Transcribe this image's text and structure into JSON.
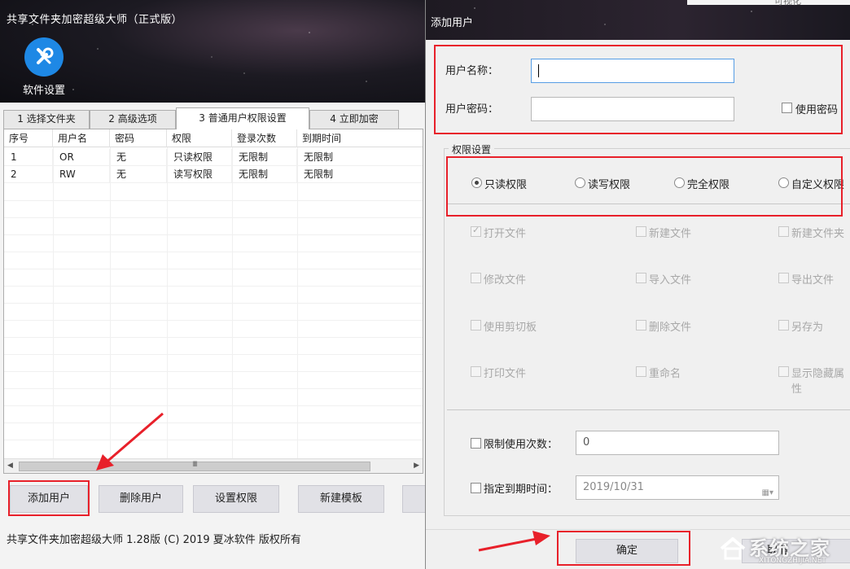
{
  "main": {
    "title": "共享文件夹加密超级大师（正式版）",
    "settings_label": "软件设置",
    "tabs": [
      {
        "label": "1 选择文件夹"
      },
      {
        "label": "2 高级选项"
      },
      {
        "label": "3 普通用户权限设置"
      },
      {
        "label": "4 立即加密"
      }
    ],
    "table": {
      "columns": [
        "序号",
        "用户名",
        "密码",
        "权限",
        "登录次数",
        "到期时间"
      ],
      "rows": [
        [
          "1",
          "OR",
          "无",
          "只读权限",
          "无限制",
          "无限制"
        ],
        [
          "2",
          "RW",
          "无",
          "读写权限",
          "无限制",
          "无限制"
        ]
      ]
    },
    "scroll_grip": "III",
    "buttons": {
      "add_user": "添加用户",
      "delete_user": "删除用户",
      "set_permission": "设置权限",
      "new_template": "新建模板"
    },
    "status": "共享文件夹加密超级大师 1.28版 (C) 2019 夏冰软件 版权所有"
  },
  "dialog": {
    "title": "添加用户",
    "top_text": "可视化",
    "username_label": "用户名称：",
    "username_value": "",
    "password_label": "用户密码：",
    "password_value": "",
    "use_password_label": "使用密码",
    "perm_group_label": "权限设置",
    "perm_modes": [
      {
        "label": "只读权限",
        "selected": true
      },
      {
        "label": "读写权限",
        "selected": false
      },
      {
        "label": "完全权限",
        "selected": false
      },
      {
        "label": "自定义权限",
        "selected": false
      }
    ],
    "perm_options": [
      [
        "打开文件",
        "新建文件",
        "新建文件夹"
      ],
      [
        "修改文件",
        "导入文件",
        "导出文件"
      ],
      [
        "使用剪切板",
        "删除文件",
        "另存为"
      ],
      [
        "打印文件",
        "重命名",
        "显示隐藏属性"
      ]
    ],
    "limit_count_label": "限制使用次数：",
    "limit_count_value": "0",
    "expire_label": "指定到期时间：",
    "expire_value": "2019/10/31",
    "ok_label": "确定",
    "cancel_label": "取消"
  },
  "watermark": {
    "text": "系统之家",
    "url": "XITONGZHIJIA.NET"
  },
  "colors": {
    "accent": "#1e88e5",
    "annotation": "#e8202a"
  }
}
